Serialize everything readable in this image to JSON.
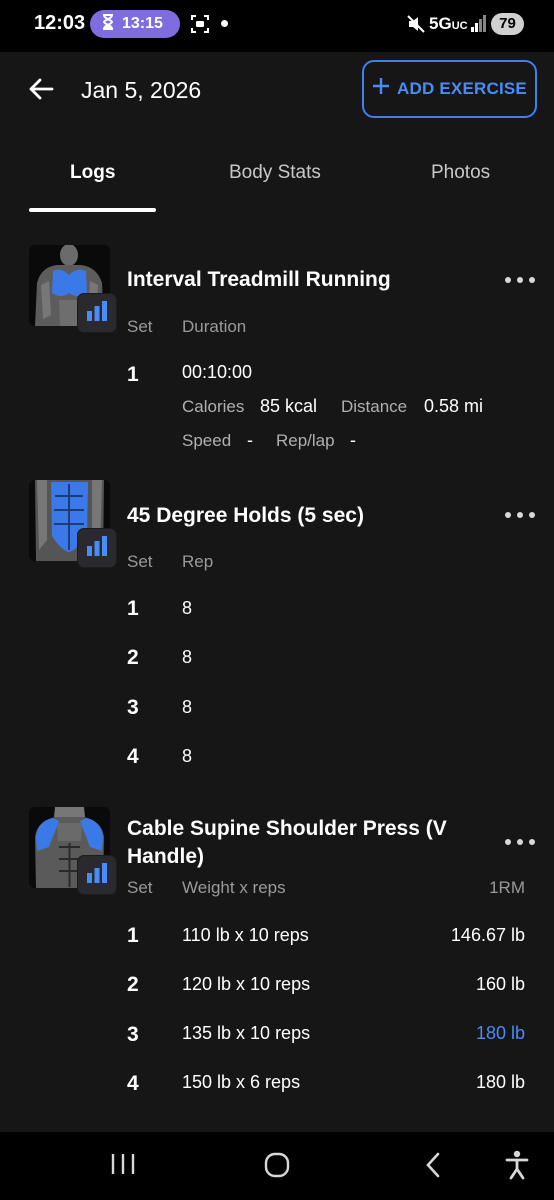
{
  "status_bar": {
    "time": "12:03",
    "timer": "13:15",
    "network": "5G",
    "network_sub": "UC",
    "battery": "79"
  },
  "header": {
    "title": "Jan 5, 2026",
    "add_button_label": "ADD EXERCISE",
    "accent_color": "#4a8cf7"
  },
  "tabs": [
    {
      "label": "Logs",
      "active": true
    },
    {
      "label": "Body Stats",
      "active": false
    },
    {
      "label": "Photos",
      "active": false
    }
  ],
  "exercises": [
    {
      "name": "Interval Treadmill Running",
      "columns": [
        "Set",
        "Duration"
      ],
      "sets": [
        {
          "set": "1",
          "duration": "00:10:00",
          "calories_label": "Calories",
          "calories": "85 kcal",
          "distance_label": "Distance",
          "distance": "0.58 mi",
          "speed_label": "Speed",
          "speed": "-",
          "replap_label": "Rep/lap",
          "replap": "-"
        }
      ]
    },
    {
      "name": "45 Degree Holds (5 sec)",
      "columns": [
        "Set",
        "Rep"
      ],
      "sets": [
        {
          "set": "1",
          "rep": "8"
        },
        {
          "set": "2",
          "rep": "8"
        },
        {
          "set": "3",
          "rep": "8"
        },
        {
          "set": "4",
          "rep": "8"
        }
      ]
    },
    {
      "name_line1": "Cable Supine Shoulder Press (V",
      "name_line2": "Handle)",
      "columns": [
        "Set",
        "Weight x reps",
        "1RM"
      ],
      "sets": [
        {
          "set": "1",
          "weight": "110 lb x 10 reps",
          "orm": "146.67 lb"
        },
        {
          "set": "2",
          "weight": "120 lb x 10 reps",
          "orm": "160 lb"
        },
        {
          "set": "3",
          "weight": "135 lb x 10 reps",
          "orm": "180 lb",
          "highlight": true
        },
        {
          "set": "4",
          "weight": "150 lb x 6 reps",
          "orm": "180 lb"
        }
      ]
    }
  ],
  "nav_bar": {
    "icons": [
      "recent-apps-icon",
      "home-icon",
      "back-icon",
      "accessibility-icon"
    ]
  }
}
